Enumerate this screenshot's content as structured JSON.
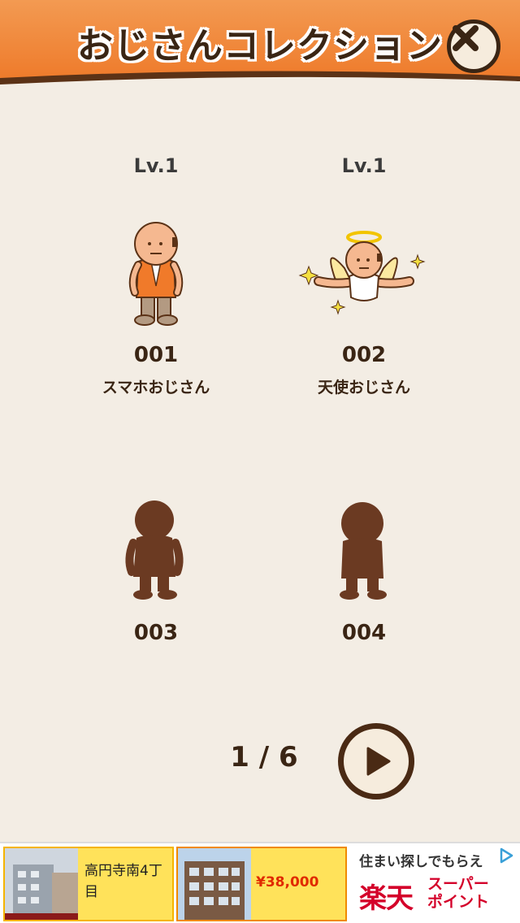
{
  "header": {
    "title": "おじさんコレクション"
  },
  "cards": [
    {
      "level": "Lv.1",
      "number": "001",
      "name": "スマホおじさん",
      "unlocked": true,
      "icon": "smartphone-ojisan-icon"
    },
    {
      "level": "Lv.1",
      "number": "002",
      "name": "天使おじさん",
      "unlocked": true,
      "icon": "angel-ojisan-icon"
    },
    {
      "number": "003",
      "unlocked": false,
      "icon": "silhouette-icon"
    },
    {
      "number": "004",
      "unlocked": false,
      "icon": "silhouette-icon"
    }
  ],
  "pager": {
    "text": "1 / 6"
  },
  "ad": {
    "tile1": {
      "text": "高円寺南4丁目"
    },
    "tile2": {
      "price": "¥38,000"
    },
    "brand": {
      "line1": "住まい探しでもらえ",
      "logo": "楽天",
      "tag1": "スーパー",
      "tag2": "ポイント"
    }
  },
  "colors": {
    "header": "#f08a3e",
    "background": "#f3ede4",
    "text": "#3a2514",
    "silhouette": "#6b3a22"
  }
}
